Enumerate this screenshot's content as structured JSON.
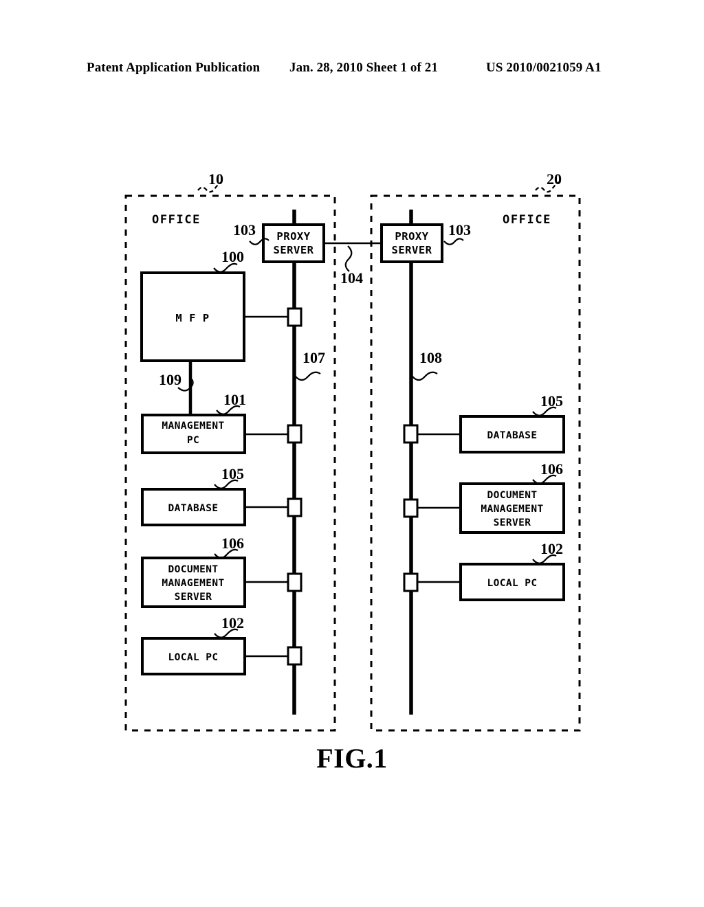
{
  "header": {
    "publication": "Patent Application Publication",
    "date_sheet": "Jan. 28, 2010  Sheet 1 of 21",
    "patent_number": "US 2010/0021059 A1"
  },
  "figure": {
    "caption": "FIG.1",
    "offices": [
      {
        "ref": "10",
        "label": "OFFICE"
      },
      {
        "ref": "20",
        "label": "OFFICE"
      }
    ],
    "left_office": {
      "proxy_server": {
        "ref": "103",
        "label_line1": "PROXY",
        "label_line2": "SERVER"
      },
      "mfp": {
        "ref": "100",
        "label": "M F P"
      },
      "management_pc": {
        "ref": "101",
        "label_line1": "MANAGEMENT",
        "label_line2": "PC"
      },
      "database": {
        "ref": "105",
        "label": "DATABASE"
      },
      "document_management_server": {
        "ref": "106",
        "label_line1": "DOCUMENT",
        "label_line2": "MANAGEMENT",
        "label_line3": "SERVER"
      },
      "local_pc": {
        "ref": "102",
        "label": "LOCAL PC"
      },
      "mfp_to_management_link": {
        "ref": "109"
      },
      "lan_bus": {
        "ref": "107"
      }
    },
    "right_office": {
      "proxy_server": {
        "ref": "103",
        "label_line1": "PROXY",
        "label_line2": "SERVER"
      },
      "database": {
        "ref": "105",
        "label": "DATABASE"
      },
      "document_management_server": {
        "ref": "106",
        "label_line1": "DOCUMENT",
        "label_line2": "MANAGEMENT",
        "label_line3": "SERVER"
      },
      "local_pc": {
        "ref": "102",
        "label": "LOCAL PC"
      },
      "lan_bus": {
        "ref": "108"
      }
    },
    "inter_office_link": {
      "ref": "104"
    }
  }
}
